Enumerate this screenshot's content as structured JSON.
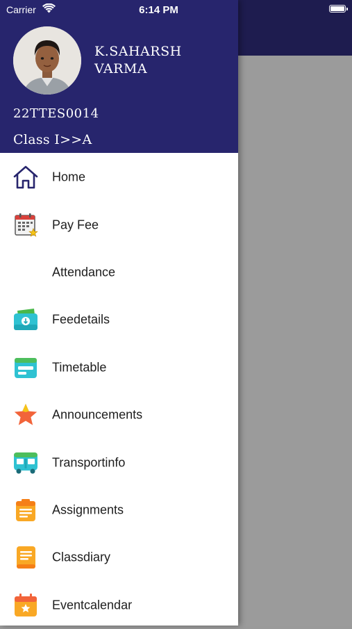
{
  "status_bar": {
    "carrier": "Carrier",
    "time": "6:14 PM"
  },
  "profile": {
    "name": "K.SAHARSH VARMA",
    "admission_no": "22TTES0014",
    "class": "Class I>>A"
  },
  "menu": [
    {
      "label": "Home",
      "icon": "home-icon"
    },
    {
      "label": "Pay Fee",
      "icon": "calendar-fee-icon"
    },
    {
      "label": "Attendance",
      "icon": ""
    },
    {
      "label": "Feedetails",
      "icon": "money-icon"
    },
    {
      "label": "Timetable",
      "icon": "timetable-icon"
    },
    {
      "label": "Announcements",
      "icon": "star-icon"
    },
    {
      "label": "Transportinfo",
      "icon": "bus-icon"
    },
    {
      "label": "Assignments",
      "icon": "assignment-icon"
    },
    {
      "label": "Classdiary",
      "icon": "diary-icon"
    },
    {
      "label": "Eventcalendar",
      "icon": "event-calendar-icon"
    }
  ],
  "colors": {
    "header": "#27256d",
    "backdrop_top": "#1e1c4f",
    "backdrop": "#9b9b9b"
  }
}
